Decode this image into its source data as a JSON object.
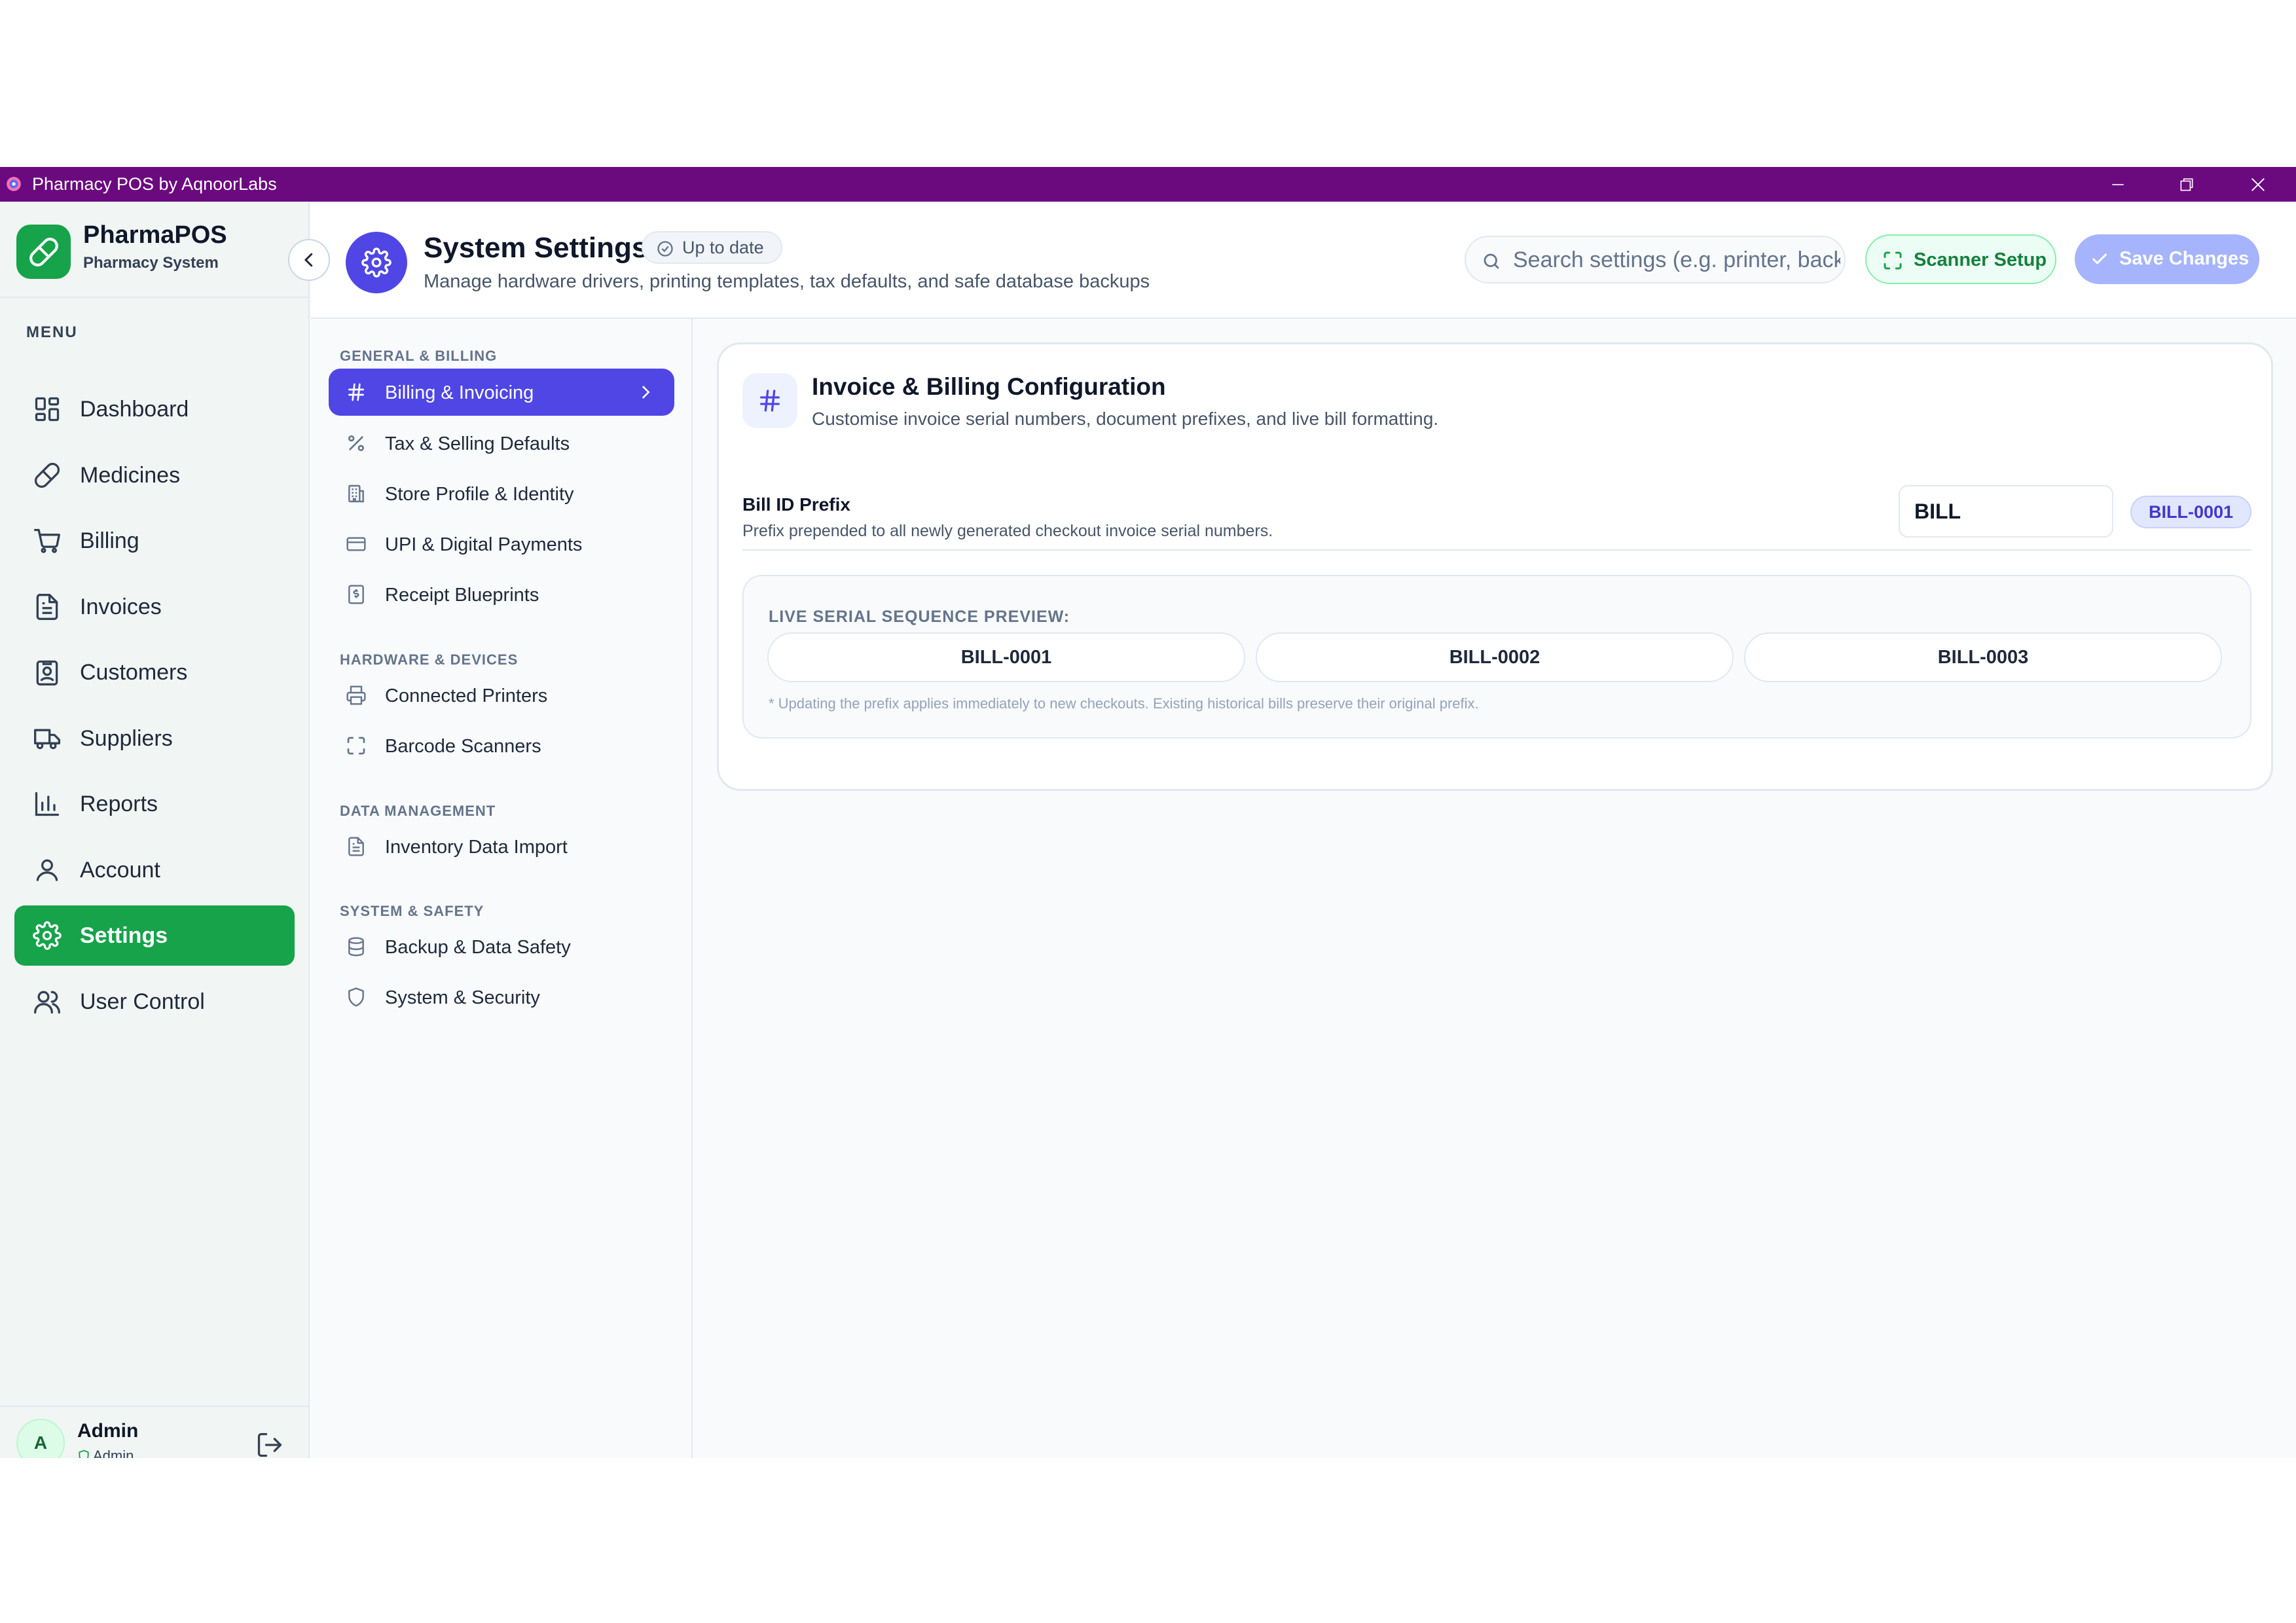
{
  "window": {
    "title": "Pharmacy POS by AqnoorLabs"
  },
  "brand": {
    "name": "PharmaPOS",
    "subtitle": "Pharmacy System"
  },
  "sidebar": {
    "menu_label": "MENU",
    "items": [
      {
        "label": "Dashboard",
        "icon": "dashboard-icon"
      },
      {
        "label": "Medicines",
        "icon": "pill-icon"
      },
      {
        "label": "Billing",
        "icon": "cart-icon"
      },
      {
        "label": "Invoices",
        "icon": "invoice-icon"
      },
      {
        "label": "Customers",
        "icon": "customers-icon"
      },
      {
        "label": "Suppliers",
        "icon": "truck-icon"
      },
      {
        "label": "Reports",
        "icon": "bar-chart-icon"
      },
      {
        "label": "Account",
        "icon": "account-icon"
      },
      {
        "label": "Settings",
        "icon": "gear-icon"
      },
      {
        "label": "User Control",
        "icon": "users-icon"
      }
    ],
    "active": "Settings"
  },
  "user": {
    "initial": "A",
    "name": "Admin",
    "role": "Admin"
  },
  "header": {
    "title": "System Settings",
    "status": "Up to date",
    "description": "Manage hardware drivers, printing templates, tax defaults, and safe database backups",
    "search_placeholder": "Search settings (e.g. printer, backup...)",
    "scanner_button": "Scanner Setup",
    "save_button": "Save Changes"
  },
  "settings_nav": {
    "sections": [
      {
        "label": "GENERAL & BILLING",
        "items": [
          {
            "label": "Billing & Invoicing",
            "icon": "hash-icon"
          },
          {
            "label": "Tax & Selling Defaults",
            "icon": "percent-icon"
          },
          {
            "label": "Store Profile & Identity",
            "icon": "building-icon"
          },
          {
            "label": "UPI & Digital Payments",
            "icon": "credit-card-icon"
          },
          {
            "label": "Receipt Blueprints",
            "icon": "receipt-icon"
          }
        ]
      },
      {
        "label": "HARDWARE & DEVICES",
        "items": [
          {
            "label": "Connected Printers",
            "icon": "printer-icon"
          },
          {
            "label": "Barcode Scanners",
            "icon": "scan-icon"
          }
        ]
      },
      {
        "label": "DATA MANAGEMENT",
        "items": [
          {
            "label": "Inventory Data Import",
            "icon": "file-icon"
          }
        ]
      },
      {
        "label": "SYSTEM & SAFETY",
        "items": [
          {
            "label": "Backup & Data Safety",
            "icon": "database-icon"
          },
          {
            "label": "System & Security",
            "icon": "shield-icon"
          }
        ]
      }
    ],
    "active": "Billing & Invoicing"
  },
  "config": {
    "title": "Invoice & Billing Configuration",
    "description": "Customise invoice serial numbers, document prefixes, and live bill formatting.",
    "prefix_label": "Bill ID Prefix",
    "prefix_help": "Prefix prepended to all newly generated checkout invoice serial numbers.",
    "prefix_value": "BILL",
    "prefix_badge": "BILL-0001",
    "preview_label": "LIVE SERIAL SEQUENCE PREVIEW:",
    "preview_serials": [
      "BILL-0001",
      "BILL-0002",
      "BILL-0003"
    ],
    "preview_note": "* Updating the prefix applies immediately to new checkouts. Existing historical bills preserve their original prefix."
  },
  "colors": {
    "titlebar": "#6b0a7f",
    "brand_green": "#16a34a",
    "accent_indigo": "#4f46e5",
    "save_disabled": "#a5b4fc"
  }
}
